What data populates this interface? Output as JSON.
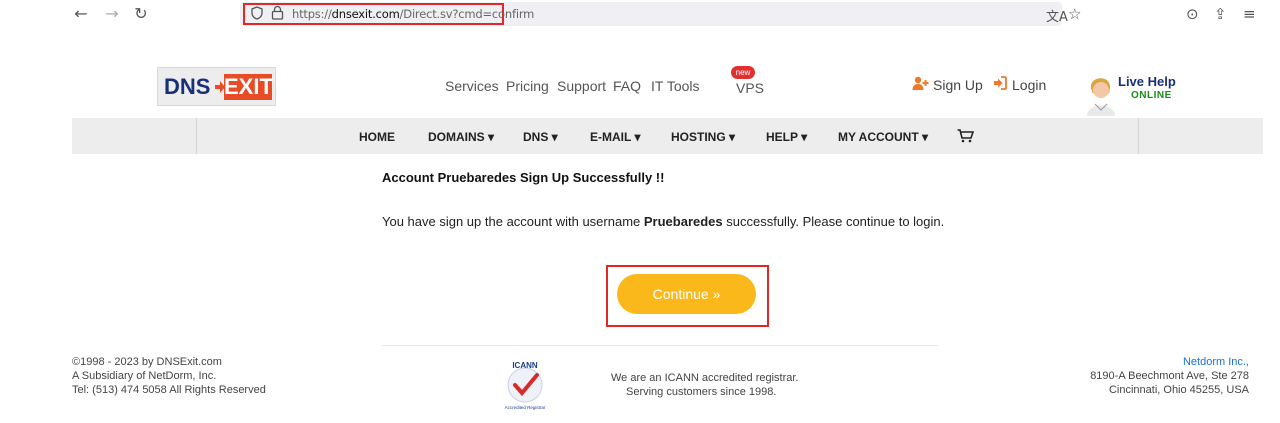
{
  "browser": {
    "url_prefix": "https://",
    "url_domain": "dnsexit.com",
    "url_path": "/Direct.sv?cmd=confirm"
  },
  "header": {
    "logo_dns": "DNS",
    "logo_exit": "EXIT",
    "top_nav": [
      "Services",
      "Pricing",
      "Support",
      "FAQ",
      "IT Tools"
    ],
    "vps_label": "VPS",
    "vps_badge": "new",
    "signup_label": "Sign Up",
    "login_label": "Login",
    "livehelp_title": "Live Help",
    "livehelp_status": "ONLINE"
  },
  "main_nav": {
    "items": [
      "HOME",
      "DOMAINS ▾",
      "DNS ▾",
      "E-MAIL ▾",
      "HOSTING ▾",
      "HELP ▾",
      "MY ACCOUNT ▾"
    ]
  },
  "content": {
    "heading": "Account Pruebaredes Sign Up Successfully !!",
    "message_pre": "You have sign up the account with username ",
    "message_username": "Pruebaredes",
    "message_post": " successfully. Please continue to login.",
    "continue_label": "Continue »"
  },
  "footer": {
    "left_1": "©1998 - 2023 by DNSExit.com",
    "left_2": "A Subsidiary of NetDorm, Inc.",
    "left_3": "Tel: (513) 474 5058 All Rights Reserved",
    "center_1": "We are an ICANN accredited registrar.",
    "center_2": "Serving customers since 1998.",
    "right_1": "Netdorm Inc.,",
    "right_2": "8190-A Beechmont Ave, Ste 278",
    "right_3": "Cincinnati, Ohio 45255, USA",
    "icann_top": "ICANN",
    "icann_bottom": "Accredited Registrar"
  },
  "colors": {
    "accent": "#fbb81b",
    "brand_blue": "#1a2f7a",
    "brand_orange": "#e84c27",
    "highlight_red": "#e32626"
  }
}
